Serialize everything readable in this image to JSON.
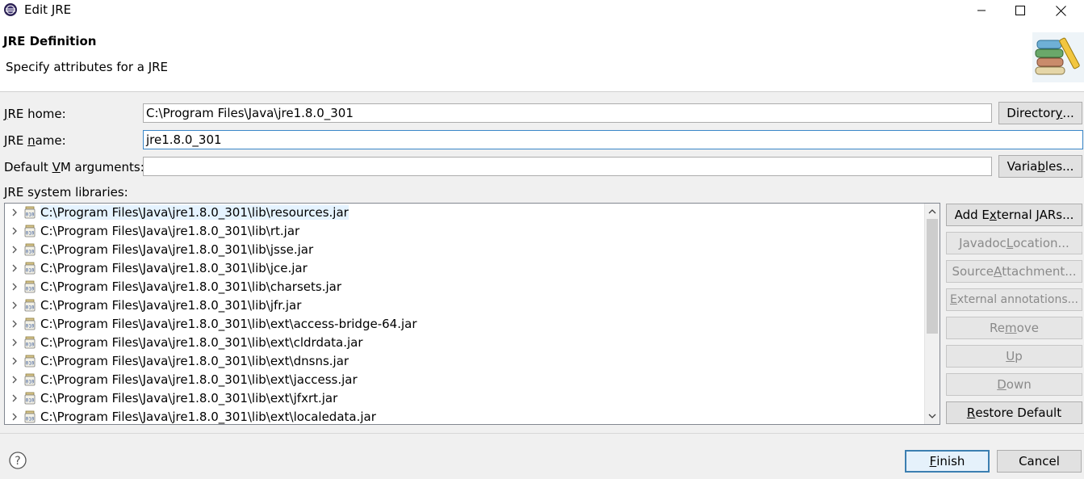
{
  "window": {
    "title": "Edit JRE",
    "icons": {
      "app": "eclipse-icon",
      "minimize": "minimize-icon",
      "maximize": "maximize-icon",
      "close": "close-icon"
    }
  },
  "banner": {
    "title": "JRE Definition",
    "subtitle": "Specify attributes for a JRE",
    "image": "jre-books-wizard-icon"
  },
  "form": {
    "jre_home": {
      "label_pre": "",
      "label_mnemonic": "J",
      "label_post": "RE home:",
      "value": "C:\\Program Files\\Java\\jre1.8.0_301"
    },
    "jre_name": {
      "label_pre": "JRE ",
      "label_mnemonic": "n",
      "label_post": "ame:",
      "value": "jre1.8.0_301"
    },
    "vm_args": {
      "label_pre": "Default ",
      "label_mnemonic": "V",
      "label_post": "M arguments:",
      "value": ""
    },
    "directory_button": {
      "pre": "Director",
      "mnemonic": "y",
      "post": "..."
    },
    "variables_button": {
      "pre": "Varia",
      "mnemonic": "b",
      "post": "les..."
    }
  },
  "libraries": {
    "label": "JRE system libraries:",
    "items": [
      "C:\\Program Files\\Java\\jre1.8.0_301\\lib\\resources.jar",
      "C:\\Program Files\\Java\\jre1.8.0_301\\lib\\rt.jar",
      "C:\\Program Files\\Java\\jre1.8.0_301\\lib\\jsse.jar",
      "C:\\Program Files\\Java\\jre1.8.0_301\\lib\\jce.jar",
      "C:\\Program Files\\Java\\jre1.8.0_301\\lib\\charsets.jar",
      "C:\\Program Files\\Java\\jre1.8.0_301\\lib\\jfr.jar",
      "C:\\Program Files\\Java\\jre1.8.0_301\\lib\\ext\\access-bridge-64.jar",
      "C:\\Program Files\\Java\\jre1.8.0_301\\lib\\ext\\cldrdata.jar",
      "C:\\Program Files\\Java\\jre1.8.0_301\\lib\\ext\\dnsns.jar",
      "C:\\Program Files\\Java\\jre1.8.0_301\\lib\\ext\\jaccess.jar",
      "C:\\Program Files\\Java\\jre1.8.0_301\\lib\\ext\\jfxrt.jar",
      "C:\\Program Files\\Java\\jre1.8.0_301\\lib\\ext\\localedata.jar"
    ],
    "buttons": {
      "add_external": {
        "pre": "Add E",
        "mnemonic": "x",
        "post": "ternal JARs..."
      },
      "javadoc": {
        "pre": "Javadoc ",
        "mnemonic": "L",
        "post": "ocation..."
      },
      "source": {
        "pre": "Source ",
        "mnemonic": "A",
        "post": "ttachment..."
      },
      "external_annotations": {
        "pre": "",
        "mnemonic": "E",
        "post": "xternal annotations..."
      },
      "remove": {
        "pre": "Re",
        "mnemonic": "m",
        "post": "ove"
      },
      "up": {
        "pre": "",
        "mnemonic": "U",
        "post": "p"
      },
      "down": {
        "pre": "",
        "mnemonic": "D",
        "post": "own"
      },
      "restore": {
        "pre": "",
        "mnemonic": "R",
        "post": "estore Default"
      }
    }
  },
  "footer": {
    "help_icon": "help-question-icon",
    "finish": {
      "pre": "",
      "mnemonic": "F",
      "post": "inish"
    },
    "cancel": "Cancel"
  }
}
